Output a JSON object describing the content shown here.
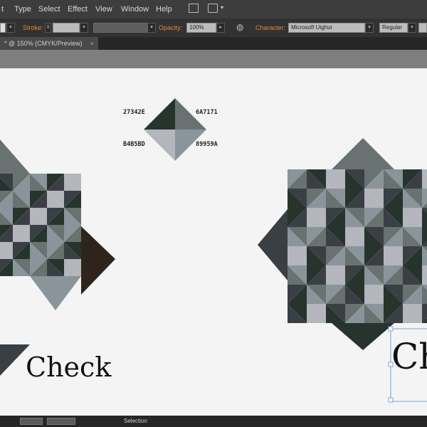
{
  "menu": {
    "items": [
      "t",
      "Type",
      "Select",
      "Effect",
      "View",
      "Window",
      "Help"
    ]
  },
  "control_bar": {
    "stroke_label": "Stroke:",
    "opacity_label": "Opacity:",
    "opacity_value": "100%",
    "character_label": "Character:",
    "font_name": "Microsoft Uighur",
    "font_style": "Regular"
  },
  "document_tab": {
    "title": "* @ 150% (CMYK/Preview)",
    "close": "×"
  },
  "swatches": {
    "top_left": "27342E",
    "top_right": "6A7171",
    "bottom_left": "B4B5BD",
    "bottom_right": "89959A"
  },
  "colors": {
    "dark": "#27342E",
    "mid_dark": "#6A7171",
    "light": "#B4B5BD",
    "mid": "#89959A",
    "shade": "#3A3F43",
    "accent_brown": "#2E241C"
  },
  "canvas_text": {
    "check_left": "Check",
    "check_right": "Ch"
  },
  "status_bar": {
    "tool_name": "Selection"
  },
  "icons": [
    "layout-icon",
    "brush-icon",
    "globe-icon",
    "chevron-down-icon"
  ]
}
